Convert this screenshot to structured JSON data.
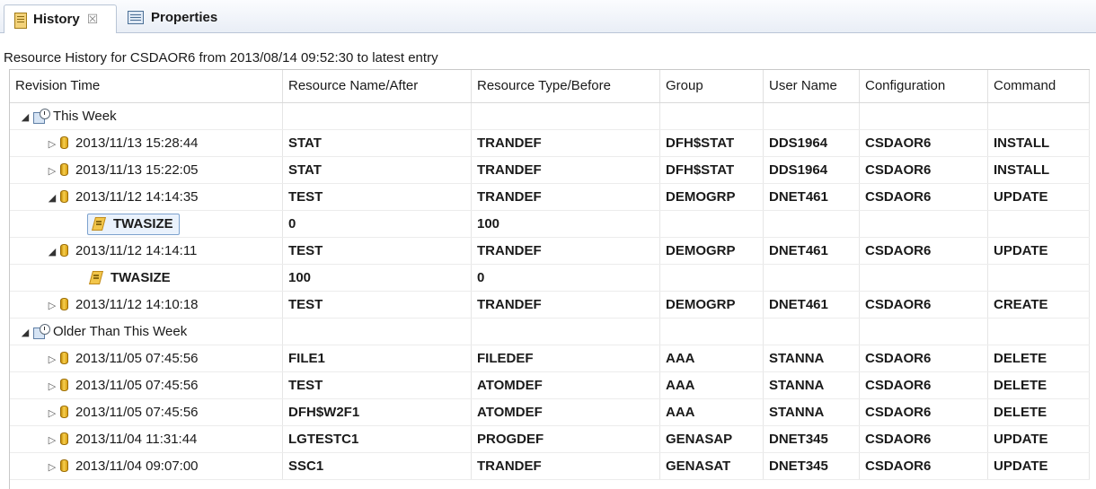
{
  "tabs": [
    {
      "label": "History",
      "close": "☒",
      "icon": "history-icon",
      "active": true
    },
    {
      "label": "Properties",
      "icon": "properties-icon",
      "active": false
    }
  ],
  "subtitle": "Resource History for CSDAOR6 from 2013/08/14 09:52:30 to latest entry",
  "columns": [
    "Revision Time",
    "Resource Name/After",
    "Resource Type/Before",
    "Group",
    "User Name",
    "Configuration",
    "Command"
  ],
  "rows": [
    {
      "kind": "group",
      "expanded": true,
      "cells": [
        "This Week",
        "",
        "",
        "",
        "",
        "",
        ""
      ]
    },
    {
      "kind": "entry",
      "expanded": false,
      "cells": [
        "2013/11/13 15:28:44",
        "STAT",
        "TRANDEF",
        "DFH$STAT",
        "DDS1964",
        "CSDAOR6",
        "INSTALL"
      ]
    },
    {
      "kind": "entry",
      "expanded": false,
      "cells": [
        "2013/11/13 15:22:05",
        "STAT",
        "TRANDEF",
        "DFH$STAT",
        "DDS1964",
        "CSDAOR6",
        "INSTALL"
      ]
    },
    {
      "kind": "entry",
      "expanded": true,
      "cells": [
        "2013/11/12 14:14:35",
        "TEST",
        "TRANDEF",
        "DEMOGRP",
        "DNET461",
        "CSDAOR6",
        "UPDATE"
      ]
    },
    {
      "kind": "attr",
      "selected": true,
      "cells": [
        "TWASIZE",
        "0",
        "100",
        "",
        "",
        "",
        ""
      ]
    },
    {
      "kind": "entry",
      "expanded": true,
      "cells": [
        "2013/11/12 14:14:11",
        "TEST",
        "TRANDEF",
        "DEMOGRP",
        "DNET461",
        "CSDAOR6",
        "UPDATE"
      ]
    },
    {
      "kind": "attr",
      "selected": false,
      "cells": [
        "TWASIZE",
        "100",
        "0",
        "",
        "",
        "",
        ""
      ]
    },
    {
      "kind": "entry",
      "expanded": false,
      "cells": [
        "2013/11/12 14:10:18",
        "TEST",
        "TRANDEF",
        "DEMOGRP",
        "DNET461",
        "CSDAOR6",
        "CREATE"
      ]
    },
    {
      "kind": "group",
      "expanded": true,
      "cells": [
        "Older Than This Week",
        "",
        "",
        "",
        "",
        "",
        ""
      ]
    },
    {
      "kind": "entry",
      "expanded": false,
      "cells": [
        "2013/11/05 07:45:56",
        "FILE1",
        "FILEDEF",
        "AAA",
        "STANNA",
        "CSDAOR6",
        "DELETE"
      ]
    },
    {
      "kind": "entry",
      "expanded": false,
      "cells": [
        "2013/11/05 07:45:56",
        "TEST",
        "ATOMDEF",
        "AAA",
        "STANNA",
        "CSDAOR6",
        "DELETE"
      ]
    },
    {
      "kind": "entry",
      "expanded": false,
      "cells": [
        "2013/11/05 07:45:56",
        "DFH$W2F1",
        "ATOMDEF",
        "AAA",
        "STANNA",
        "CSDAOR6",
        "DELETE"
      ]
    },
    {
      "kind": "entry",
      "expanded": false,
      "cells": [
        "2013/11/04 11:31:44",
        "LGTESTC1",
        "PROGDEF",
        "GENASAP",
        "DNET345",
        "CSDAOR6",
        "UPDATE"
      ]
    },
    {
      "kind": "entry",
      "expanded": false,
      "cells": [
        "2013/11/04 09:07:00",
        "SSC1",
        "TRANDEF",
        "GENASAT",
        "DNET345",
        "CSDAOR6",
        "UPDATE"
      ]
    }
  ]
}
